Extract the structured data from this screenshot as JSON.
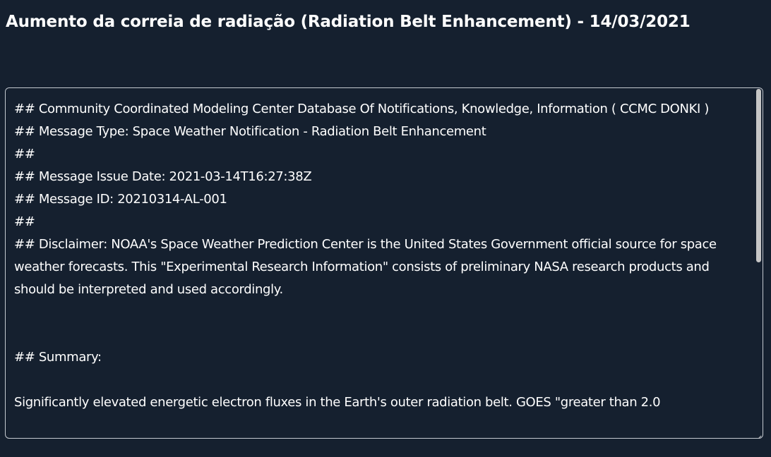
{
  "page": {
    "title": "Aumento da correia de radiação (Radiation Belt Enhancement) - 14/03/2021"
  },
  "message": {
    "lines": [
      "## Community Coordinated Modeling Center Database Of Notifications, Knowledge, Information ( CCMC DONKI )",
      "## Message Type: Space Weather Notification - Radiation Belt Enhancement",
      "##",
      "## Message Issue Date: 2021-03-14T16:27:38Z",
      "## Message ID: 20210314-AL-001",
      "##",
      "## Disclaimer: NOAA's Space Weather Prediction Center is the United States Government official source for space weather forecasts. This \"Experimental Research Information\" consists of preliminary NASA research products and should be interpreted and used accordingly.",
      "",
      "## Summary:",
      "",
      "Significantly elevated energetic electron fluxes in the Earth's outer radiation belt. GOES \"greater than 2.0"
    ]
  },
  "colors": {
    "background": "#15202f",
    "text": "#ffffff",
    "border": "#c4c9d0",
    "scrollbar_thumb": "#c6c6c6"
  },
  "icons": {
    "resize_handle": "resize-grip-icon"
  }
}
